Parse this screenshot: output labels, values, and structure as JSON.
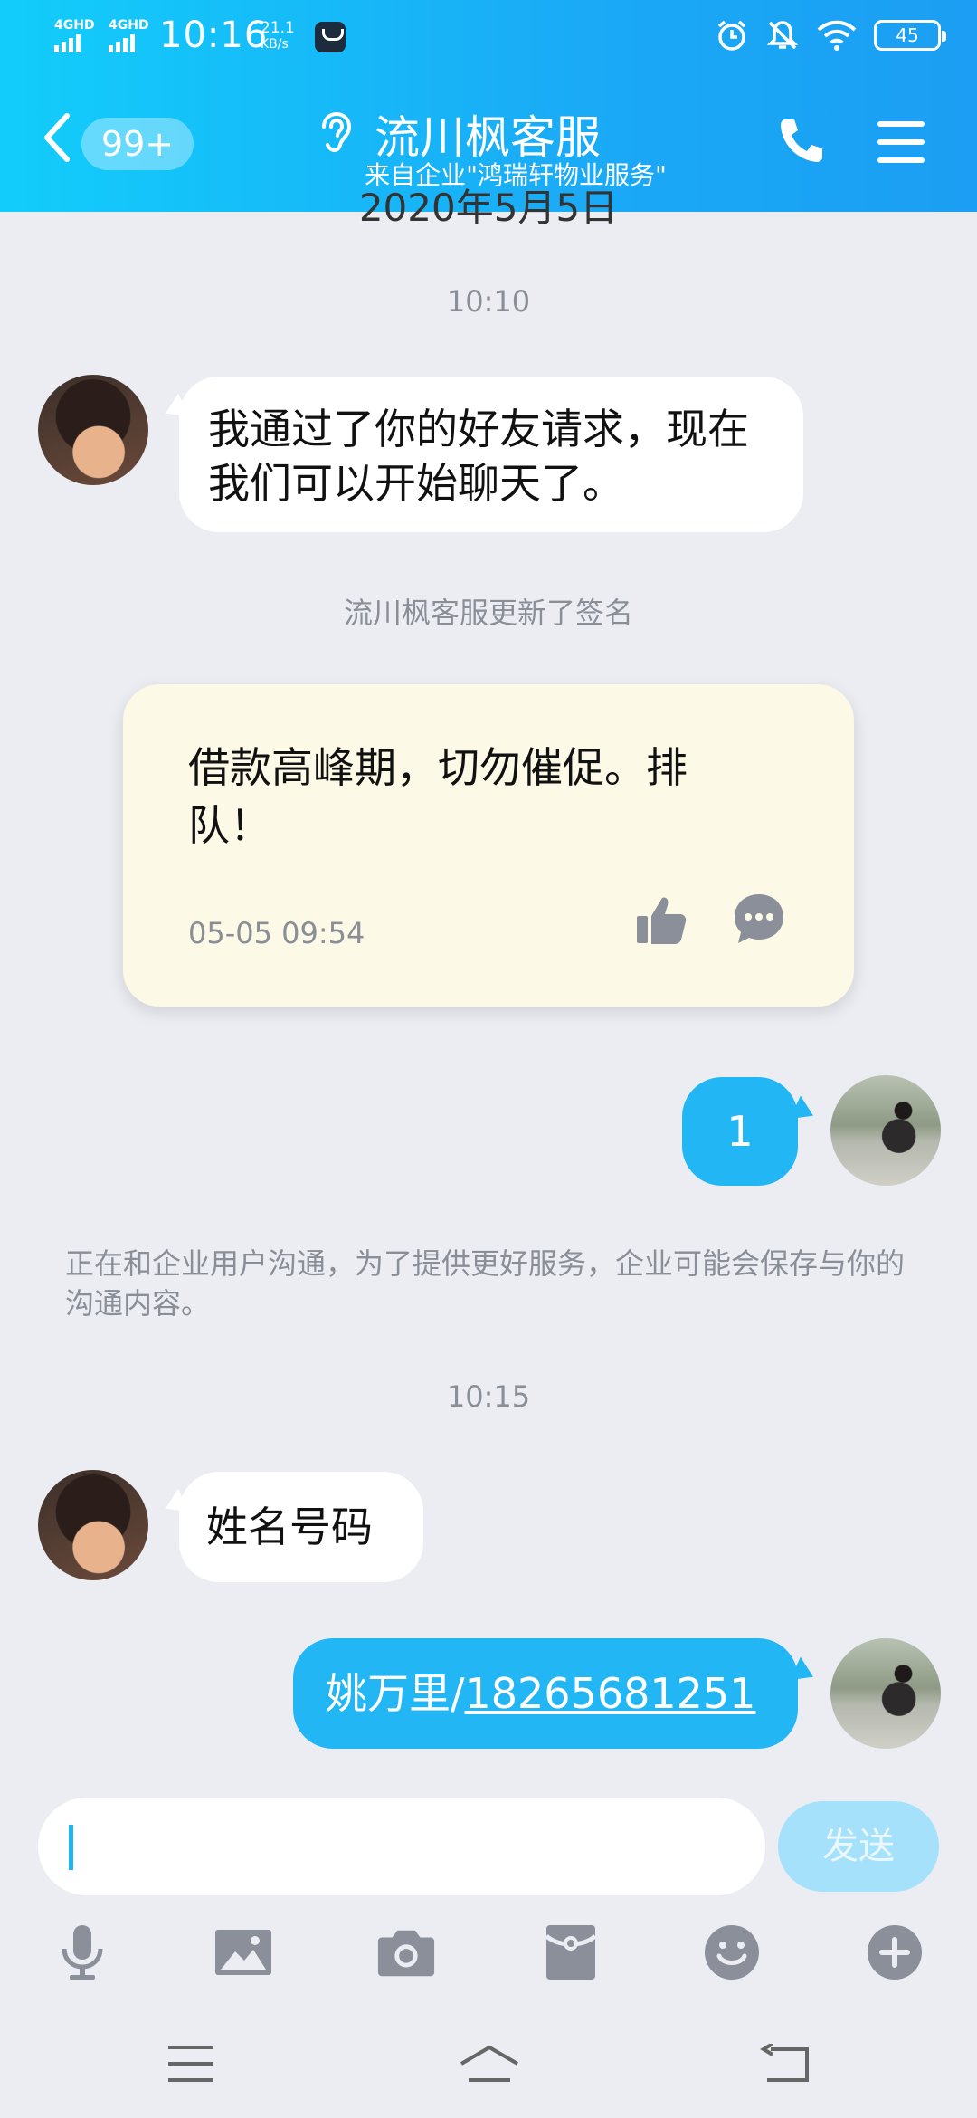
{
  "status_bar": {
    "network_1": "4GHD",
    "network_2": "4GHD",
    "time": "10:16",
    "speed_value": "21.1",
    "speed_unit": "KB/s",
    "battery": "45"
  },
  "header": {
    "badge": "99+",
    "title": "流川枫客服",
    "subtitle": "来自企业\"鸿瑞轩物业服务\""
  },
  "chat": {
    "partial_date": "2020年5月5日",
    "time_1": "10:10",
    "msg_1": "我通过了你的好友请求，现在我们可以开始聊天了。",
    "system_1": "流川枫客服更新了签名",
    "card": {
      "text": "借款高峰期，切勿催促。排队！",
      "time": "05-05 09:54"
    },
    "msg_2": "1",
    "notice": "正在和企业用户沟通，为了提供更好服务，企业可能会保存与你的沟通内容。",
    "time_2": "10:15",
    "msg_3": "姓名号码",
    "msg_4_name": "姚万里/",
    "msg_4_phone": "18265681251"
  },
  "input": {
    "value": "",
    "send_label": "发送"
  },
  "colors": {
    "header_start": "#12cdfb",
    "header_end": "#1b9ef3",
    "bubble_out": "#22b6f4",
    "background": "#ebedf3",
    "card_bg": "#fdf9e7"
  },
  "icons": [
    "back-icon",
    "ear-icon",
    "phone-icon",
    "menu-icon",
    "like-icon",
    "comment-icon",
    "microphone-icon",
    "image-icon",
    "camera-icon",
    "red-packet-icon",
    "emoji-icon",
    "plus-icon"
  ]
}
